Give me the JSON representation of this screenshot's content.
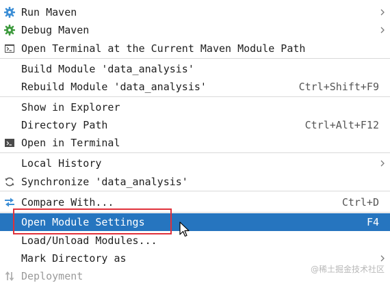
{
  "menu": {
    "items": {
      "run_maven": {
        "label": "Run Maven",
        "icon": "gear-icon"
      },
      "debug_maven": {
        "label": "Debug Maven",
        "icon": "debug-gear-icon"
      },
      "open_terminal_maven": {
        "label": "Open Terminal at the Current Maven Module Path",
        "icon": "terminal-icon"
      },
      "build_module": {
        "label": "Build Module 'data_analysis'"
      },
      "rebuild_module": {
        "label": "Rebuild Module 'data_analysis'",
        "shortcut": "Ctrl+Shift+F9"
      },
      "show_in_explorer": {
        "label": "Show in Explorer"
      },
      "directory_path": {
        "label": "Directory Path",
        "shortcut": "Ctrl+Alt+F12"
      },
      "open_in_terminal": {
        "label": "Open in Terminal",
        "icon": "terminal-icon"
      },
      "local_history": {
        "label": "Local History"
      },
      "synchronize": {
        "label": "Synchronize 'data_analysis'",
        "icon": "sync-icon"
      },
      "compare_with": {
        "label": "Compare With...",
        "shortcut": "Ctrl+D",
        "icon": "compare-icon"
      },
      "open_module_settings": {
        "label": "Open Module Settings",
        "shortcut": "F4"
      },
      "load_unload_modules": {
        "label": "Load/Unload Modules..."
      },
      "mark_directory_as": {
        "label": "Mark Directory as"
      },
      "deployment": {
        "label": "Deployment",
        "icon": "deployment-icon"
      }
    }
  },
  "watermark": "@稀土掘金技术社区",
  "colors": {
    "selection": "#2675bf",
    "highlight_box": "#e0303a",
    "separator": "#d9d9d9",
    "disabled_text": "#9a9a9a"
  }
}
